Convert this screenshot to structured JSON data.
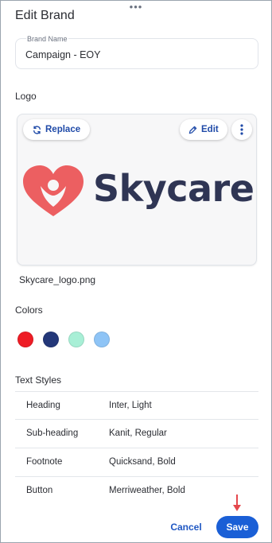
{
  "dialog": {
    "title": "Edit Brand",
    "drag_handle": "•••"
  },
  "brand_name": {
    "label": "Brand Name",
    "value": "Campaign - EOY"
  },
  "logo": {
    "section_label": "Logo",
    "replace_label": "Replace",
    "edit_label": "Edit",
    "more_icon": "more-vertical-icon",
    "wordmark": "Skycare",
    "filename": "Skycare_logo.png",
    "brand_colors": {
      "heart": "#ec5f61",
      "wordmark": "#2f3554"
    }
  },
  "colors": {
    "section_label": "Colors",
    "swatches": [
      {
        "name": "red",
        "hex": "#ee1c25"
      },
      {
        "name": "navy",
        "hex": "#233779"
      },
      {
        "name": "mint",
        "hex": "#a8efd6"
      },
      {
        "name": "sky-blue",
        "hex": "#8ec4f6"
      }
    ]
  },
  "text_styles": {
    "section_label": "Text Styles",
    "rows": [
      {
        "name": "Heading",
        "font": "Inter, Light"
      },
      {
        "name": "Sub-heading",
        "font": "Kanit, Regular"
      },
      {
        "name": "Footnote",
        "font": "Quicksand, Bold"
      },
      {
        "name": "Button",
        "font": "Merriweather, Bold"
      }
    ]
  },
  "footer": {
    "cancel_label": "Cancel",
    "save_label": "Save",
    "accent": "#1a5fd6",
    "arrow_color": "#e5484d"
  }
}
